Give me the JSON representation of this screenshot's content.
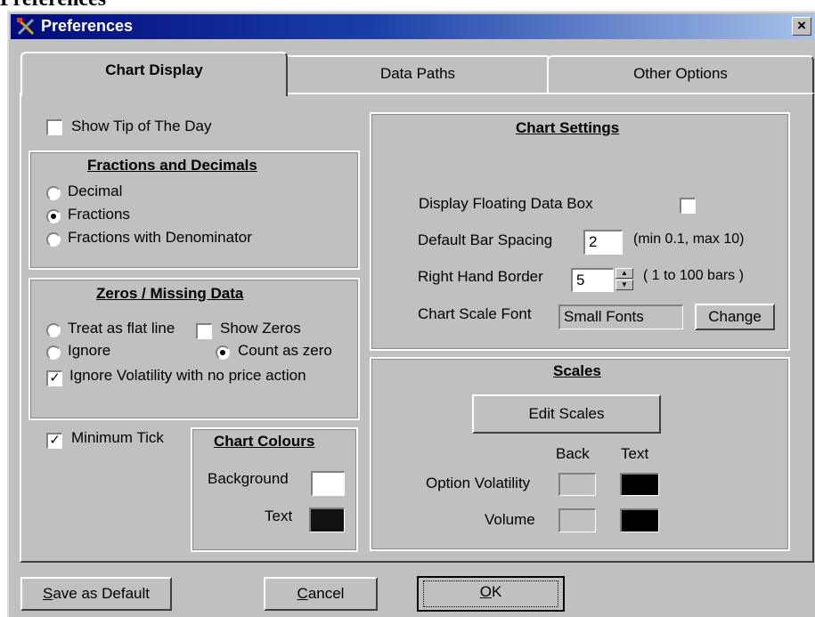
{
  "page_heading": "Preferences",
  "window": {
    "title": "Preferences",
    "close_symbol": "×",
    "icon": "tools-icon"
  },
  "tabs": [
    {
      "label": "Chart Display",
      "active": true
    },
    {
      "label": "Data Paths",
      "active": false
    },
    {
      "label": "Other Options",
      "active": false
    }
  ],
  "chart_display": {
    "show_tip": {
      "label": "Show Tip of The Day",
      "checked": false
    },
    "fractions": {
      "title": "Fractions and Decimals",
      "options": [
        {
          "label": "Decimal",
          "selected": false
        },
        {
          "label": "Fractions",
          "selected": true
        },
        {
          "label": "Fractions with Denominator",
          "selected": false
        }
      ]
    },
    "zeros": {
      "title": "Zeros / Missing Data",
      "treat_flat": {
        "label": "Treat as flat line",
        "selected": false
      },
      "ignore": {
        "label": "Ignore",
        "selected": false
      },
      "show_zeros": {
        "label": "Show Zeros",
        "checked": false
      },
      "count_zero": {
        "label": "Count as zero",
        "selected": true
      },
      "ignore_volatility": {
        "label": "Ignore Volatility with no price action",
        "checked": true
      }
    },
    "minimum_tick": {
      "label": "Minimum Tick",
      "checked": true
    },
    "colours": {
      "title": "Chart Colours",
      "background_label": "Background",
      "background_color": "#ffffff",
      "text_label": "Text",
      "text_color": "#111111"
    },
    "chart_settings": {
      "title": "Chart Settings",
      "floating_box_label": "Display Floating Data Box",
      "floating_box_checked": false,
      "bar_spacing_label": "Default Bar Spacing",
      "bar_spacing_value": "2",
      "bar_spacing_hint": "(min 0.1, max 10)",
      "border_label": "Right Hand Border",
      "border_value": "5",
      "border_hint": "( 1 to 100 bars )",
      "font_label": "Chart Scale Font",
      "font_value": "Small Fonts",
      "change_label": "Change"
    },
    "scales": {
      "title": "Scales",
      "edit_label": "Edit Scales",
      "back_header": "Back",
      "text_header": "Text",
      "rows": [
        {
          "label": "Option Volatility",
          "back_color": "#c0c0c0",
          "text_color": "#000000"
        },
        {
          "label": "Volume",
          "back_color": "#c0c0c0",
          "text_color": "#000000"
        }
      ]
    }
  },
  "footer": {
    "save_prefix": "S",
    "save_rest": "ave as Default",
    "cancel_prefix": "C",
    "cancel_rest": "ancel",
    "ok_prefix": "O",
    "ok_rest": "K"
  }
}
